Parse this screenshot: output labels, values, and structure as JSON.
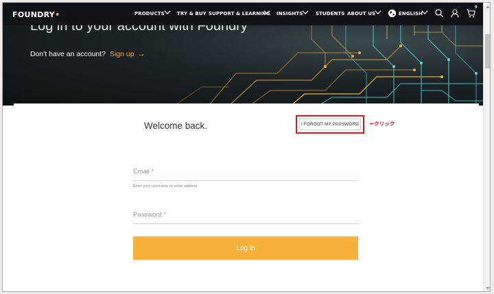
{
  "brand": {
    "name": "FOUNDRY",
    "accent": "#f2a93b"
  },
  "nav": {
    "items": [
      {
        "label": "PRODUCTS",
        "has_dropdown": true
      },
      {
        "label": "TRY & BUY",
        "has_dropdown": false
      },
      {
        "label": "SUPPORT & LEARNING",
        "has_dropdown": true
      },
      {
        "label": "INSIGHTS",
        "has_dropdown": true
      },
      {
        "label": "STUDENTS",
        "has_dropdown": false
      },
      {
        "label": "ABOUT US",
        "has_dropdown": true
      }
    ],
    "language": "ENGLISH",
    "cart_count": "0",
    "icons": [
      "globe-icon",
      "search-icon",
      "user-icon",
      "cart-icon"
    ]
  },
  "hero": {
    "title": "Log in to your account with Foundry",
    "prompt": "Don't have an account?",
    "signup_link": "Sign up",
    "signup_arrow": "→"
  },
  "login": {
    "welcome": "Welcome back.",
    "forgot_password": "I FORGOT MY PASSWORD",
    "annotation": "←クリック",
    "email": {
      "label": "Email *",
      "hint": "Enter your username or email address",
      "value": ""
    },
    "password": {
      "label": "Password *",
      "value": ""
    },
    "submit": "Log in",
    "button_color": "#f8b23a",
    "highlight_color": "#e0141e"
  }
}
